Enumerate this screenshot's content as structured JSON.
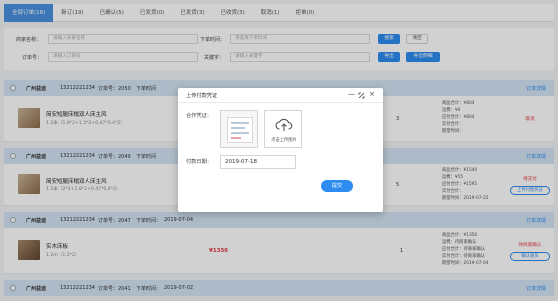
{
  "tabs": [
    "全部订单(18)",
    "新订(19)",
    "已确认(5)",
    "已发货(0)",
    "已发货(3)",
    "已收货(3)",
    "取消(1)",
    "拒单(0)"
  ],
  "filters": {
    "store_label": "商家名称：",
    "store_placeholder": "请输入商家名称",
    "time_label": "下单时间：",
    "time_placeholder": "请选择下单时间",
    "order_label": "订单号：",
    "order_placeholder": "请输入订单号",
    "keyword_label": "关键字：",
    "keyword_placeholder": "请输入关键字",
    "search_btn": "搜索",
    "clear_btn": "清空",
    "export_btn": "导出",
    "export_detail_btn": "导出明细"
  },
  "orders": [
    {
      "shop": "广州益迪",
      "phone": "13212221234",
      "order_no": "订单号：2050",
      "time_label": "下单时间",
      "time": "",
      "detail_link": "订单详情",
      "product": "简安短腿床榻双人床主风",
      "spec": "1.2米（1.8*2+1.5*2+0.47*0.4*2）",
      "price": "",
      "qty": "3",
      "summary": [
        "商品合计：¥804",
        "运费：¥0",
        "应付合计：¥804",
        "实付合计：",
        "期望时间："
      ],
      "status": "取消",
      "action": ""
    },
    {
      "shop": "广州益迪",
      "phone": "13212221234",
      "order_no": "订单号：2049",
      "time_label": "下单时间",
      "time": "",
      "detail_link": "订单详情",
      "product": "简安短腿床榻双人床主风",
      "spec": "1.5米（2*2+1.8*2+0.47*0.4*2）",
      "price": "",
      "qty": "5",
      "summary": [
        "商品合计：¥1540",
        "运费：¥55",
        "应付合计：¥1595",
        "实付合计：",
        "期望时间：2019-07-25"
      ],
      "status": "待支付",
      "action": "上传付款凭证"
    },
    {
      "shop": "广州益迪",
      "phone": "13212221234",
      "order_no": "订单号：2047",
      "time_label": "下单时间：",
      "time": "2019-07-04",
      "detail_link": "订单详情",
      "product": "实木床板",
      "spec": "1.2m（1.2*2）",
      "price": "¥1356",
      "qty": "1",
      "summary": [
        "商品合计：¥1356",
        "运费：待商家确认",
        "应付合计：待商家确认",
        "实付合计：待商家确认",
        "期望时间：2019-07-04"
      ],
      "status": "待商家确认",
      "action": "确认收货"
    },
    {
      "shop": "广州益迪",
      "phone": "13212221234",
      "order_no": "订单号：2041",
      "time_label": "下单时间：",
      "time": "2019-07-02",
      "detail_link": "订单详情"
    }
  ],
  "modal": {
    "title": "上传付款凭证",
    "voucher_label": "合作凭证：",
    "upload_label": "点击上传图片",
    "date_label": "付款日期：",
    "date_value": "2019-07-18",
    "submit": "提交",
    "icons": [
      "minimize-icon",
      "maximize-icon",
      "close-icon",
      "cloud-upload-icon"
    ]
  },
  "colors": {
    "primary": "#2d8cf0",
    "header_row": "#d4e4f5",
    "price": "#e0393e"
  }
}
